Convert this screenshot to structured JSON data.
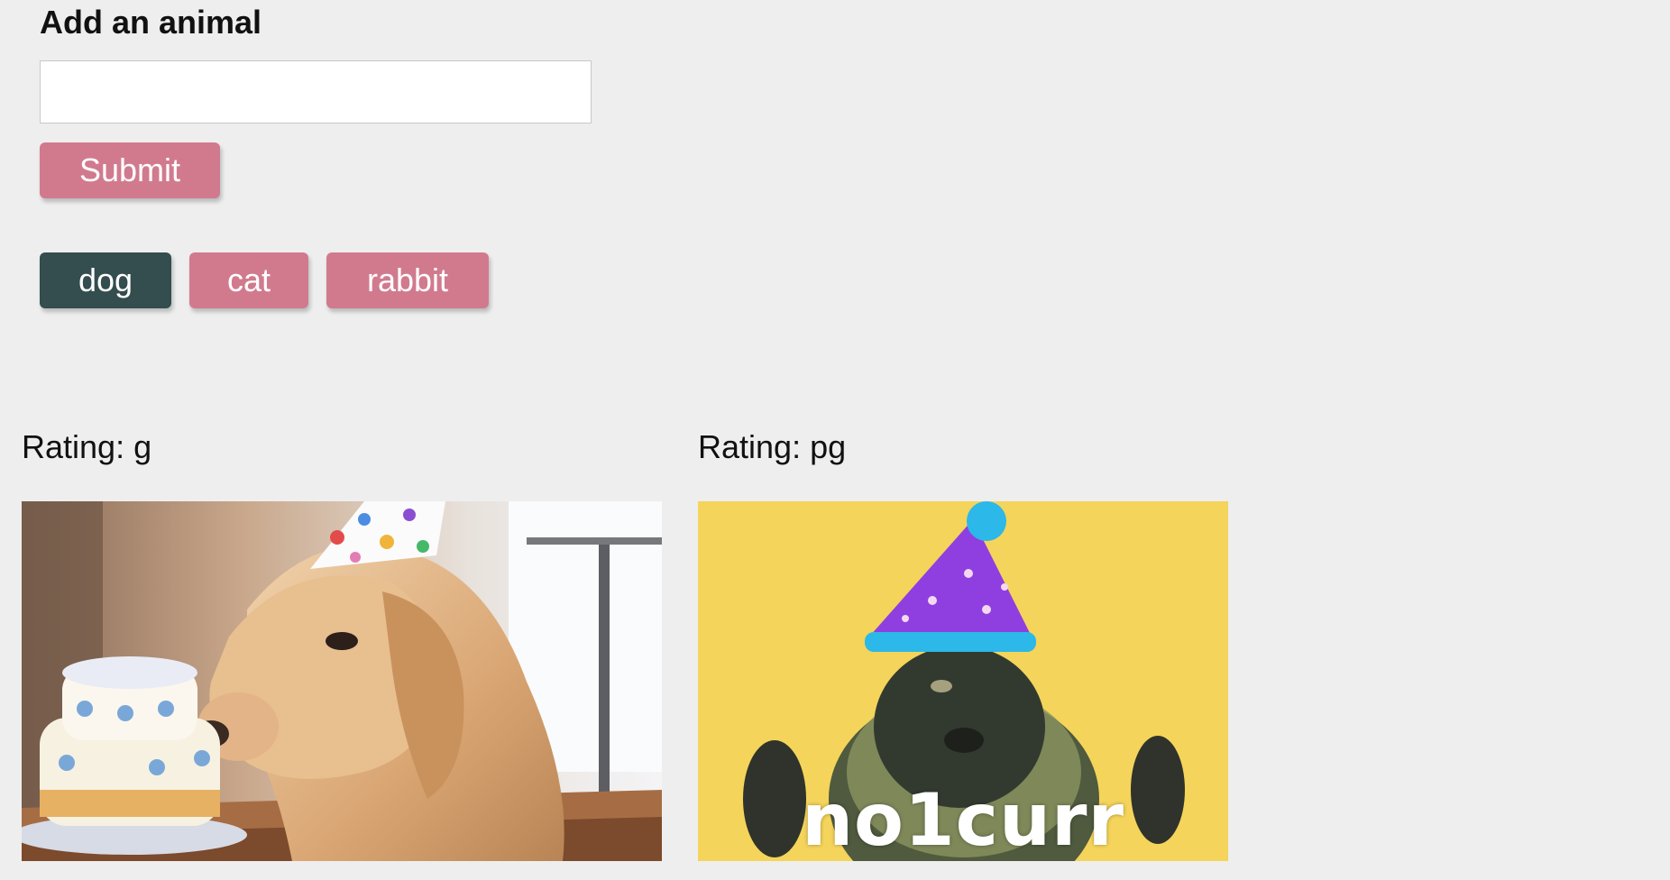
{
  "form": {
    "title": "Add an animal",
    "input_value": "",
    "input_placeholder": "",
    "submit_label": "Submit"
  },
  "animals": [
    {
      "label": "dog",
      "selected": true
    },
    {
      "label": "cat",
      "selected": false
    },
    {
      "label": "rabbit",
      "selected": false
    }
  ],
  "results": [
    {
      "rating": "Rating: g",
      "image": "dog-birthday-cake-gif",
      "caption": ""
    },
    {
      "rating": "Rating: pg",
      "image": "dog-party-hat-gif",
      "caption": "no1curr"
    }
  ],
  "colors": {
    "background": "#eeeeee",
    "button": "#d17a8e",
    "button_selected": "#344d4e",
    "text": "#111111"
  }
}
